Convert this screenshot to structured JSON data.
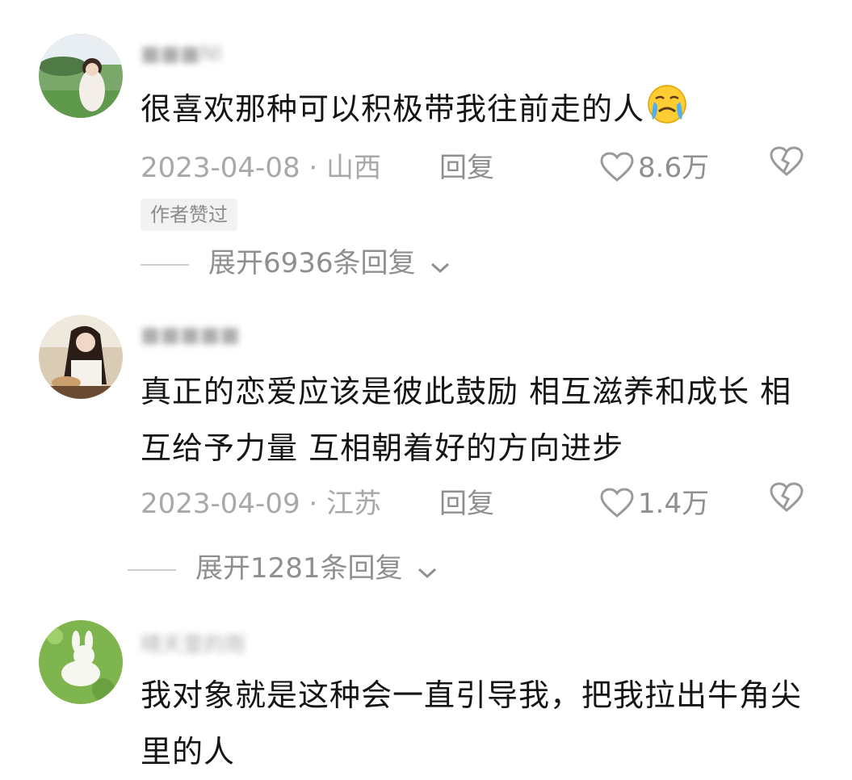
{
  "comments": [
    {
      "username": "■■■NI",
      "content": "很喜欢那种可以积极带我往前走的人",
      "emoji": "crying-face-emoji",
      "date_region": "2023-04-08 · 山西",
      "reply_label": "回复",
      "likes": "8.6万",
      "badge": "作者赞过",
      "expand_label": "展开6936条回复"
    },
    {
      "username": "■■■■■",
      "content": "真正的恋爱应该是彼此鼓励 相互滋养和成长 相互给予力量 互相朝着好的方向进步",
      "date_region": "2023-04-09 · 江苏",
      "reply_label": "回复",
      "likes": "1.4万",
      "expand_label": "展开1281条回复"
    },
    {
      "username": "晴天里的雨",
      "content": "我对象就是这种会一直引导我，把我拉出牛角尖里的人"
    }
  ],
  "colors": {
    "text": "#151515",
    "meta": "#a8a8a8",
    "accent_bg": "#f2f2f2"
  },
  "icons": [
    "heart-outline-icon",
    "broken-heart-icon",
    "chevron-down-icon"
  ]
}
